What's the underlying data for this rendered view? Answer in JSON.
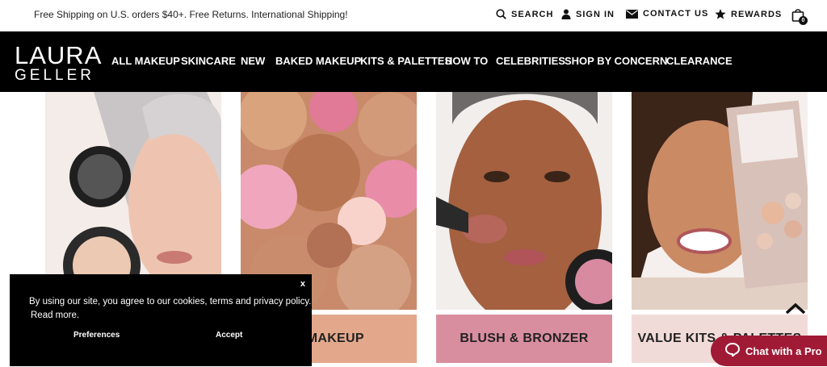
{
  "topbar": {
    "shipping_message": "Free Shipping on U.S. orders $40+. Free Returns. International Shipping!",
    "search_label": "SEARCH",
    "signin_label": "SIGN IN",
    "contact_label": "CONTACT US",
    "rewards_label": "REWARDS",
    "cart_count": "0"
  },
  "logo": {
    "line1": "LAURA",
    "line2": "GELLER"
  },
  "nav": {
    "all_makeup": "ALL MAKEUP",
    "skincare": "SKINCARE",
    "new": "NEW",
    "baked_makeup": "BAKED MAKEUP",
    "kits_palettes": "KITS & PALETTES",
    "how_to": "HOW TO",
    "celebrities": "CELEBRITIES",
    "shop_by_concern": "SHOP BY CONCERN",
    "clearance": "CLEARANCE"
  },
  "tiles": [
    {
      "caption": "",
      "color": "#e9cfc2"
    },
    {
      "caption": "D MAKEUP",
      "color": "#e3a88b"
    },
    {
      "caption": "BLUSH & BRONZER",
      "color": "#d98ea0"
    },
    {
      "caption": "VALUE KITS & PALETTES",
      "color": "#f1dbd8"
    }
  ],
  "cookie": {
    "message": "By using our site, you agree to our cookies, terms and privacy policy.",
    "read_more": "Read more.",
    "preferences": "Preferences",
    "accept": "Accept",
    "close": "x"
  },
  "chat": {
    "label": "Chat with a Pro"
  },
  "colors": {
    "nav_bg": "#000000",
    "chat_bg": "#a01a36"
  }
}
